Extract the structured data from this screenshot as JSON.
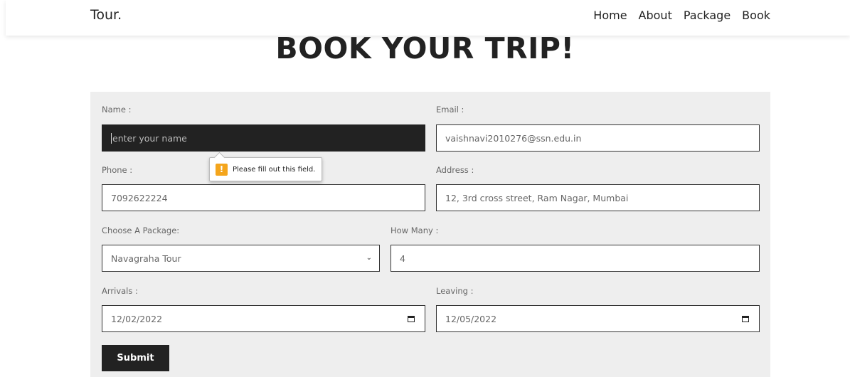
{
  "header": {
    "logo": "Tour.",
    "nav": [
      "Home",
      "About",
      "Package",
      "Book"
    ]
  },
  "heading": "BOOK YOUR TRIP!",
  "form": {
    "name": {
      "label": "Name :",
      "placeholder": "enter your name",
      "value": ""
    },
    "email": {
      "label": "Email :",
      "value": "vaishnavi2010276@ssn.edu.in"
    },
    "phone": {
      "label": "Phone :",
      "value": "7092622224"
    },
    "address": {
      "label": "Address :",
      "value": "12, 3rd cross street, Ram Nagar, Mumbai"
    },
    "package": {
      "label": "Choose A Package:",
      "value": "Navagraha Tour"
    },
    "how_many": {
      "label": "How Many :",
      "value": "4"
    },
    "arrivals": {
      "label": "Arrivals :",
      "value": "12/02/2022"
    },
    "leaving": {
      "label": "Leaving :",
      "value": "12/05/2022"
    },
    "submit_label": "Submit"
  },
  "tooltip": {
    "text": "Please fill out this field.",
    "icon": "warning-icon",
    "color": "#f4a51c"
  }
}
